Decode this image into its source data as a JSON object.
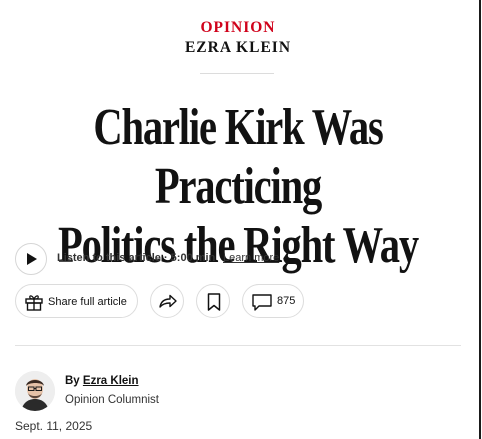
{
  "kicker": {
    "section": "OPINION",
    "author": "EZRA KLEIN"
  },
  "headline": {
    "line1": "Charlie Kirk Was Practicing",
    "line2": "Politics the Right Way"
  },
  "audio": {
    "play_icon": "play-icon",
    "listen_text": "Listen to this article · 5:00 min",
    "learn_more": "Learn more"
  },
  "actions": {
    "share_full_label": "Share full article",
    "gift_icon": "gift-icon",
    "share_icon": "share-arrow-icon",
    "save_icon": "bookmark-icon",
    "comment_icon": "comment-icon",
    "comment_count": "875"
  },
  "byline": {
    "by": "By",
    "author_name": "Ezra Klein",
    "role": "Opinion Columnist",
    "date": "Sept. 11, 2025"
  },
  "colors": {
    "section_red": "#d0021b",
    "text": "#121212",
    "border": "#dcdcdc"
  }
}
